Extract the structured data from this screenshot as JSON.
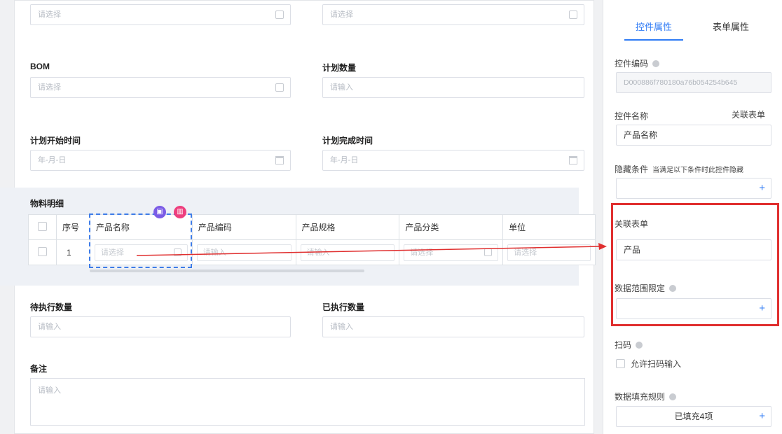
{
  "form": {
    "row0": {
      "left_placeholder": "请选择",
      "right_placeholder": "请选择"
    },
    "bom": {
      "label": "BOM",
      "placeholder": "请选择"
    },
    "plan_qty": {
      "label": "计划数量",
      "placeholder": "请输入"
    },
    "plan_start": {
      "label": "计划开始时间",
      "placeholder": "年-月-日"
    },
    "plan_end": {
      "label": "计划完成时间",
      "placeholder": "年-月-日"
    },
    "materials": {
      "title": "物料明细",
      "columns": [
        "序号",
        "产品名称",
        "产品编码",
        "产品规格",
        "产品分类",
        "单位"
      ],
      "row": {
        "index": "1",
        "cells": [
          "请选择",
          "请输入",
          "请输入",
          "请选择",
          "请选择"
        ]
      }
    },
    "pending_qty": {
      "label": "待执行数量",
      "placeholder": "请输入"
    },
    "done_qty": {
      "label": "已执行数量",
      "placeholder": "请输入"
    },
    "remark": {
      "label": "备注",
      "placeholder": "请输入"
    }
  },
  "panel": {
    "tabs": [
      "控件属性",
      "表单属性"
    ],
    "control_code": {
      "label": "控件编码",
      "value": "D000886f780180a76b054254b645"
    },
    "control_name": {
      "label": "控件名称",
      "type": "关联表单",
      "value": "产品名称"
    },
    "hidden_condition": {
      "label": "隐藏条件",
      "hint": "当满足以下条件时此控件隐藏"
    },
    "linked_form": {
      "label": "关联表单",
      "value": "产品"
    },
    "data_scope": {
      "label": "数据范围限定"
    },
    "scan": {
      "label": "扫码",
      "checkbox_label": "允许扫码输入"
    },
    "fill_rule": {
      "label": "数据填充规则",
      "value": "已填充4项"
    }
  },
  "colors": {
    "accent": "#2f7bf5",
    "highlight": "#e02f2f",
    "select_dash": "#3e7ce8"
  }
}
